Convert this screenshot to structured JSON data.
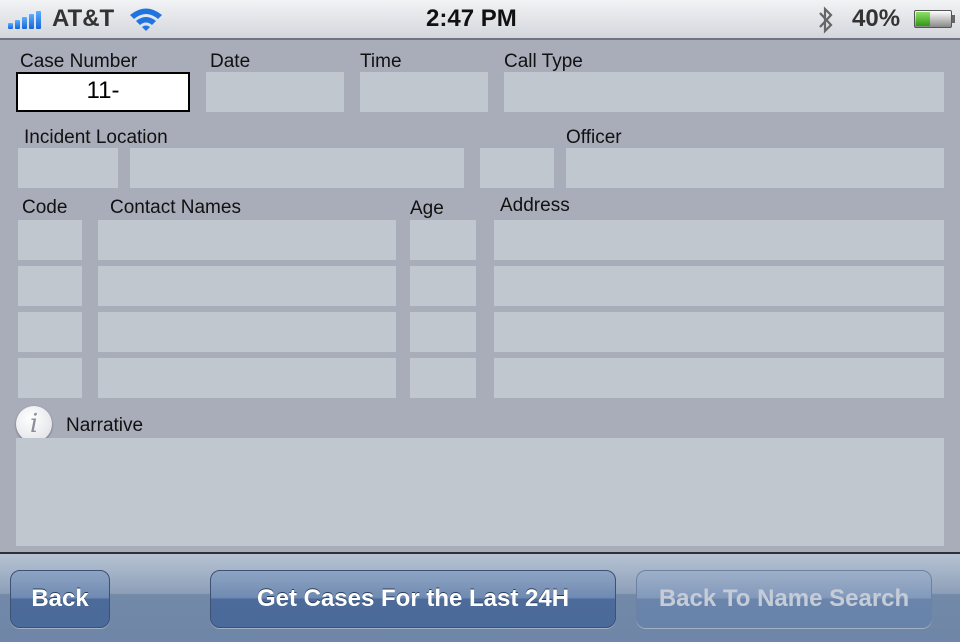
{
  "status_bar": {
    "carrier": "AT&T",
    "time": "2:47 PM",
    "battery_percent_label": "40%",
    "battery_level": 0.4,
    "icons": [
      "signal-bars-icon",
      "wifi-icon",
      "bluetooth-icon",
      "battery-icon"
    ]
  },
  "form": {
    "case_number": {
      "label": "Case Number",
      "value": "11-"
    },
    "date": {
      "label": "Date",
      "value": ""
    },
    "time": {
      "label": "Time",
      "value": ""
    },
    "call_type": {
      "label": "Call Type",
      "value": ""
    },
    "incident_location": {
      "label": "Incident Location",
      "values": [
        "",
        "",
        ""
      ]
    },
    "officer": {
      "label": "Officer",
      "value": ""
    },
    "contacts": {
      "headers": {
        "code": "Code",
        "names": "Contact Names",
        "age": "Age",
        "address": "Address"
      },
      "rows": [
        {
          "code": "",
          "name": "",
          "age": "",
          "address": ""
        },
        {
          "code": "",
          "name": "",
          "age": "",
          "address": ""
        },
        {
          "code": "",
          "name": "",
          "age": "",
          "address": ""
        },
        {
          "code": "",
          "name": "",
          "age": "",
          "address": ""
        }
      ]
    },
    "narrative": {
      "label": "Narrative",
      "value": "",
      "info_icon": "i"
    }
  },
  "toolbar": {
    "back_label": "Back",
    "get_cases_label": "Get Cases For the Last 24H",
    "back_to_name_search_label": "Back To Name Search"
  }
}
